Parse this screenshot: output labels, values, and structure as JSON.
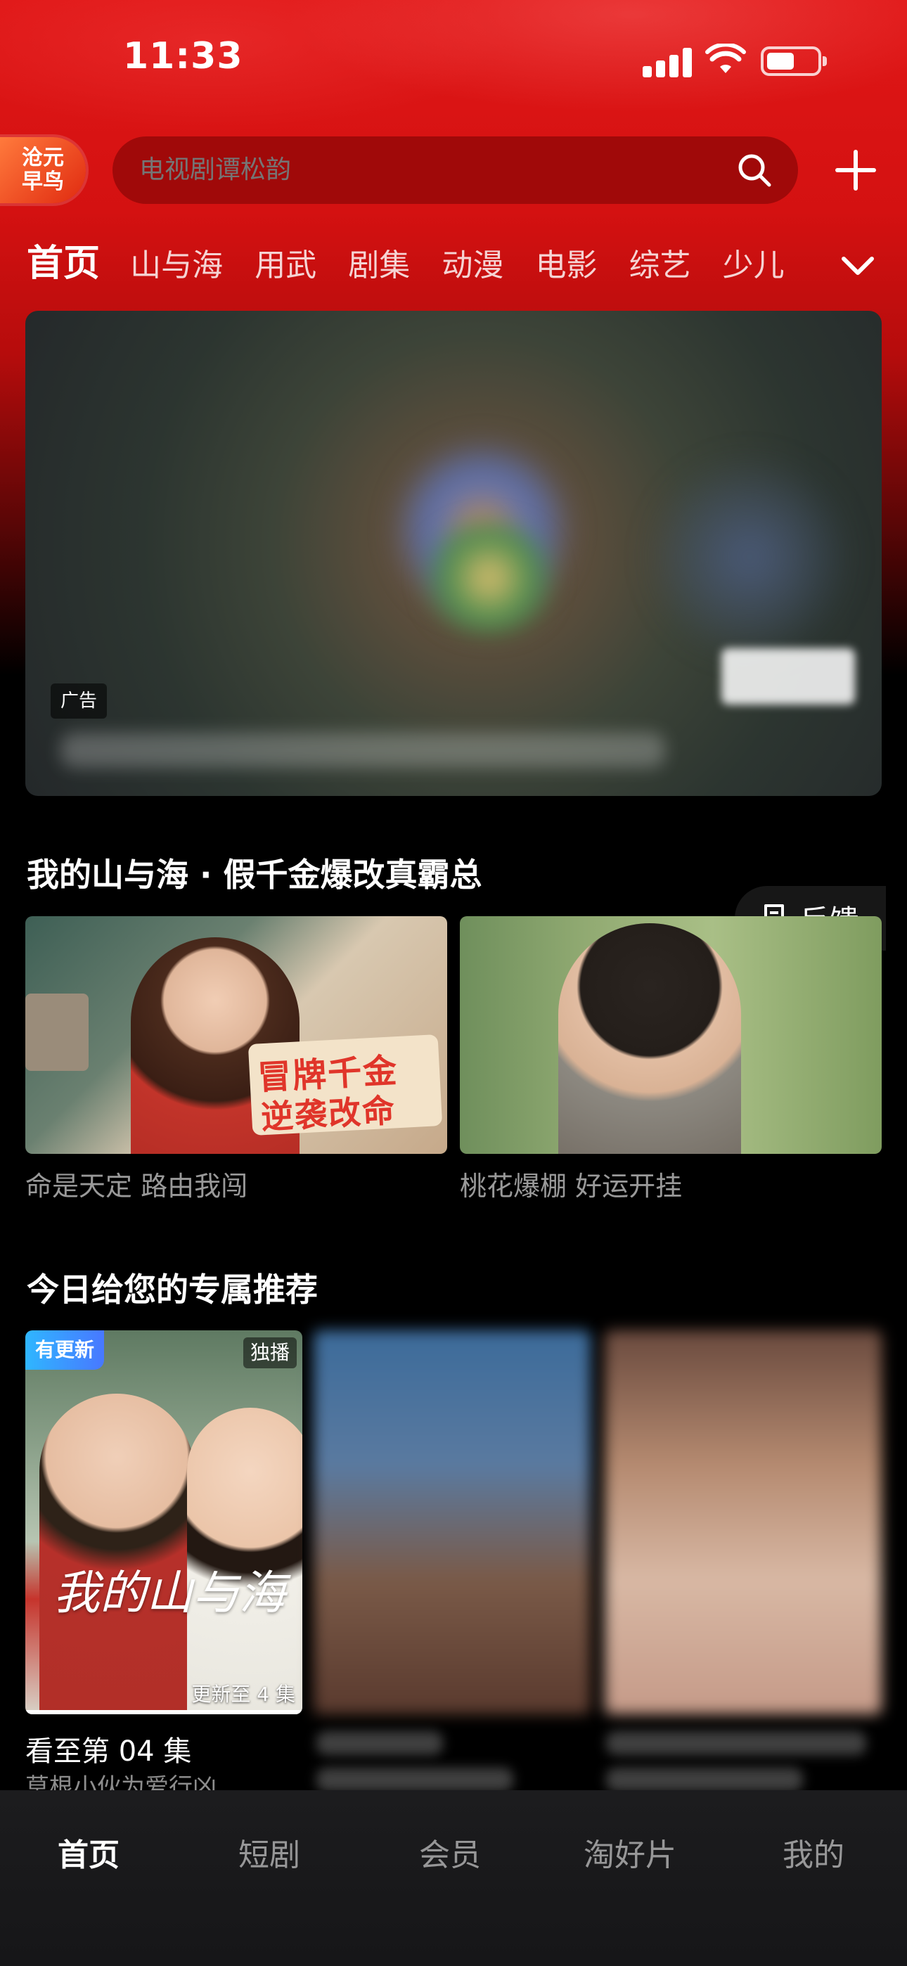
{
  "status_bar": {
    "time": "11:33"
  },
  "header": {
    "logo_text": "沧元早鸟",
    "search_placeholder": "电视剧谭松韵"
  },
  "tabs": [
    {
      "label": "首页",
      "active": true
    },
    {
      "label": "山与海"
    },
    {
      "label": "用武"
    },
    {
      "label": "剧集"
    },
    {
      "label": "动漫"
    },
    {
      "label": "电影"
    },
    {
      "label": "综艺"
    },
    {
      "label": "少儿"
    }
  ],
  "banner": {
    "ad_label": "广告"
  },
  "section1": {
    "title": "我的山与海 · 假千金爆改真霸总",
    "feedback_label": "反馈",
    "cards": [
      {
        "poster_line1": "冒牌千金",
        "poster_line2": "逆袭改命",
        "subtitle": "命是天定 路由我闯"
      },
      {
        "subtitle": "桃花爆棚 好运开挂"
      }
    ]
  },
  "section2": {
    "title": "今日给您的专属推荐",
    "items": [
      {
        "badge_new": "有更新",
        "badge_exclusive": "独播",
        "poster_title": "我的山与海",
        "update_label": "更新至 4 集",
        "watch_progress": "看至第 04 集",
        "description": "草根小伙为爱行凶"
      }
    ]
  },
  "bottom_nav": [
    {
      "label": "首页",
      "active": true
    },
    {
      "label": "短剧"
    },
    {
      "label": "会员"
    },
    {
      "label": "淘好片"
    },
    {
      "label": "我的"
    }
  ],
  "colors": {
    "brand_red": "#e01717",
    "background": "#000000",
    "nav_bg": "#1c1c1e"
  }
}
